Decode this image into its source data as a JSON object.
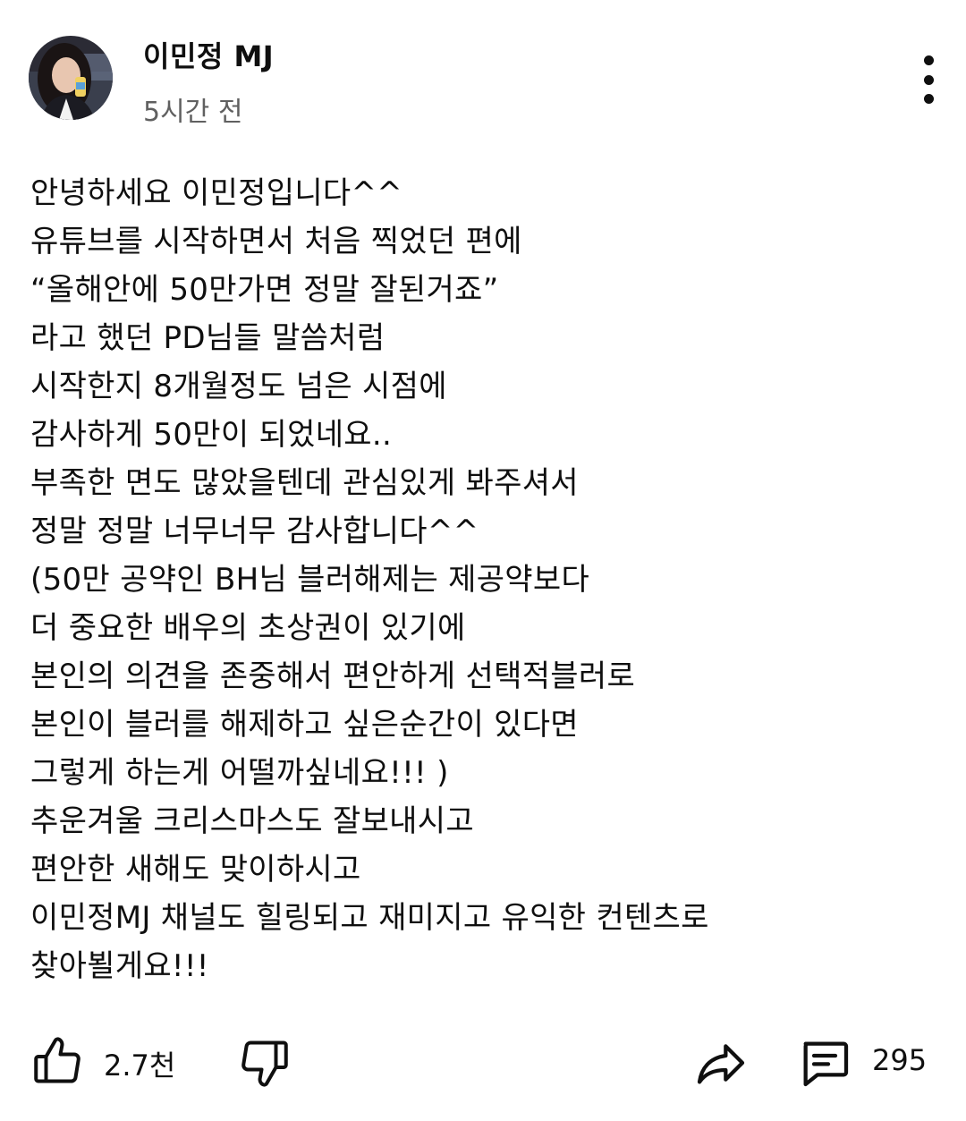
{
  "post": {
    "author": "이민정 MJ",
    "time": "5시간 전",
    "lines": [
      "안녕하세요 이민정입니다^^",
      "유튜브를 시작하면서 처음 찍었던 편에",
      "“올해안에 50만가면 정말 잘된거죠”",
      "라고 했던 PD님들 말씀처럼",
      "시작한지 8개월정도 넘은 시점에",
      "감사하게 50만이 되었네요..",
      "부족한 면도 많았을텐데 관심있게 봐주셔서",
      "정말 정말 너무너무 감사합니다^^",
      "(50만 공약인 BH님 블러해제는 제공약보다",
      "더 중요한 배우의 초상권이 있기에",
      "본인의 의견을 존중해서 편안하게 선택적블러로",
      "본인이 블러를 해제하고 싶은순간이 있다면",
      "그렇게 하는게 어떨까싶네요!!! )",
      "추운겨울 크리스마스도 잘보내시고",
      "편안한 새해도 맞이하시고",
      "이민정MJ 채널도 힐링되고 재미지고 유익한 컨텐츠로",
      "찾아뵐게요!!!"
    ]
  },
  "actions": {
    "like_count": "2.7천",
    "comment_count": "295",
    "icons": [
      "thumb-up-icon",
      "thumb-down-icon",
      "share-icon",
      "comment-icon"
    ]
  }
}
